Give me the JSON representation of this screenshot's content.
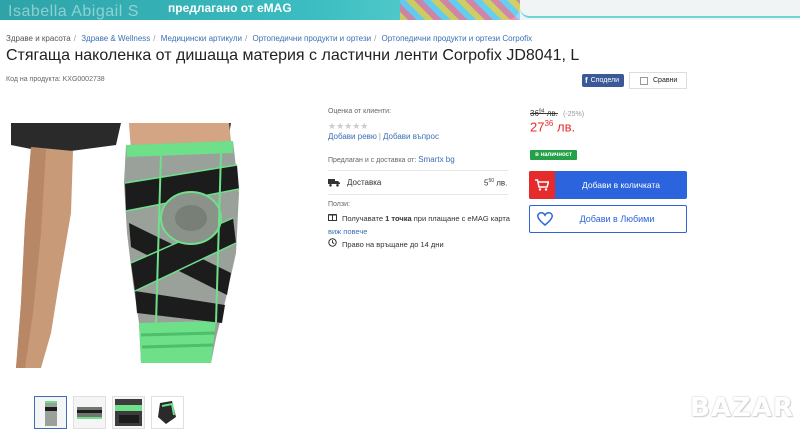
{
  "banner": {
    "text": "предлагано от eMAG",
    "watermark": "Isabella Abigail S"
  },
  "breadcrumb": [
    "Здраве и красота",
    "Здраве & Wellness",
    "Медицински артикули",
    "Ортопедични продукти и ортези",
    "Ортопедични продукти и ортези Corpofix"
  ],
  "product": {
    "title": "Стягаща наколенка от дишаща материя с ластични ленти Corpofix JD8041, L",
    "code": "Код на продукта: KXG0002738"
  },
  "social": {
    "share_label": "Сподели",
    "share_icon": "facebook-icon",
    "compare_label": "Сравни"
  },
  "rating": {
    "label": "Оценка от клиенти:",
    "stars": "★★★★★",
    "add_review": "Добави ревю",
    "add_question": "Добави въпрос"
  },
  "seller": {
    "label": "Предлаган и с доставка от:",
    "name": "Smartx bg"
  },
  "delivery": {
    "label": "Доставка",
    "price_int": "5",
    "price_dec": "50",
    "currency": "лв."
  },
  "benefits": {
    "label": "Ползи:",
    "points_pre": "Получавате",
    "points_bold": "1 точка",
    "points_post": "при плащане с eMAG карта",
    "see_more": "виж повече",
    "return": "Право на връщане до 14 дни"
  },
  "price": {
    "old_int": "36",
    "old_dec": "94",
    "currency": "лв.",
    "discount": "(-25%)",
    "new_int": "27",
    "new_dec": "36",
    "stock": "в наличност"
  },
  "actions": {
    "add_to_cart": "Добави в количката",
    "add_to_favorites": "Добави в Любими"
  },
  "logo": "BAZAR",
  "colors": {
    "accent_blue": "#2b64dc",
    "price_red": "#e52b2b",
    "stock_green": "#24a148",
    "link_blue": "#3b6fb6",
    "brace_green": "#6fe08a"
  }
}
